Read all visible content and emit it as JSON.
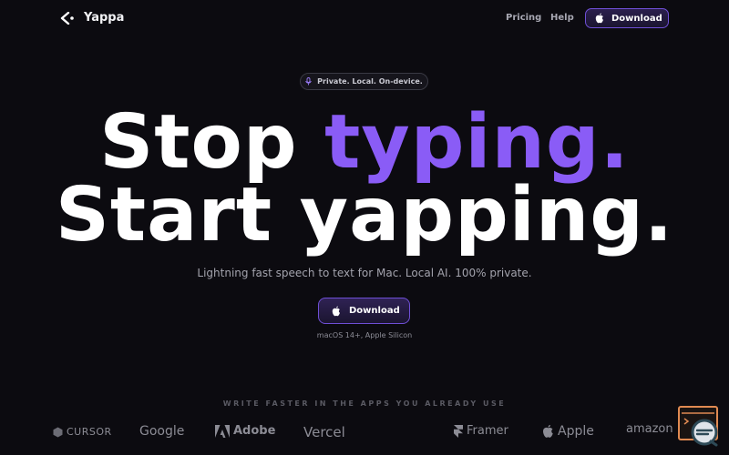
{
  "nav": {
    "brand": "Yappa",
    "links": [
      "Pricing",
      "Help"
    ],
    "download_label": "Download"
  },
  "hero": {
    "badge": "Private. Local. On-device.",
    "line1_a": "Stop ",
    "line1_b": "typing.",
    "line2": "Start yapping.",
    "subtitle": "Lightning fast speech to text for Mac. Local AI. 100% private.",
    "cta_label": "Download",
    "requirements": "macOS 14+, Apple Silicon"
  },
  "apps": {
    "heading": "WRITE FASTER IN THE APPS YOU ALREADY USE",
    "brands": [
      "CURSOR",
      "Google",
      "Adobe",
      "Vercel",
      "Framer",
      "Apple",
      "amazon"
    ]
  },
  "colors": {
    "accent": "#8a5cf6",
    "background": "#0c0b10",
    "button_border": "#6f4fd6"
  },
  "icons": [
    "yappa-logo-icon",
    "apple-icon",
    "microphone-icon",
    "chat-widget-icon"
  ]
}
